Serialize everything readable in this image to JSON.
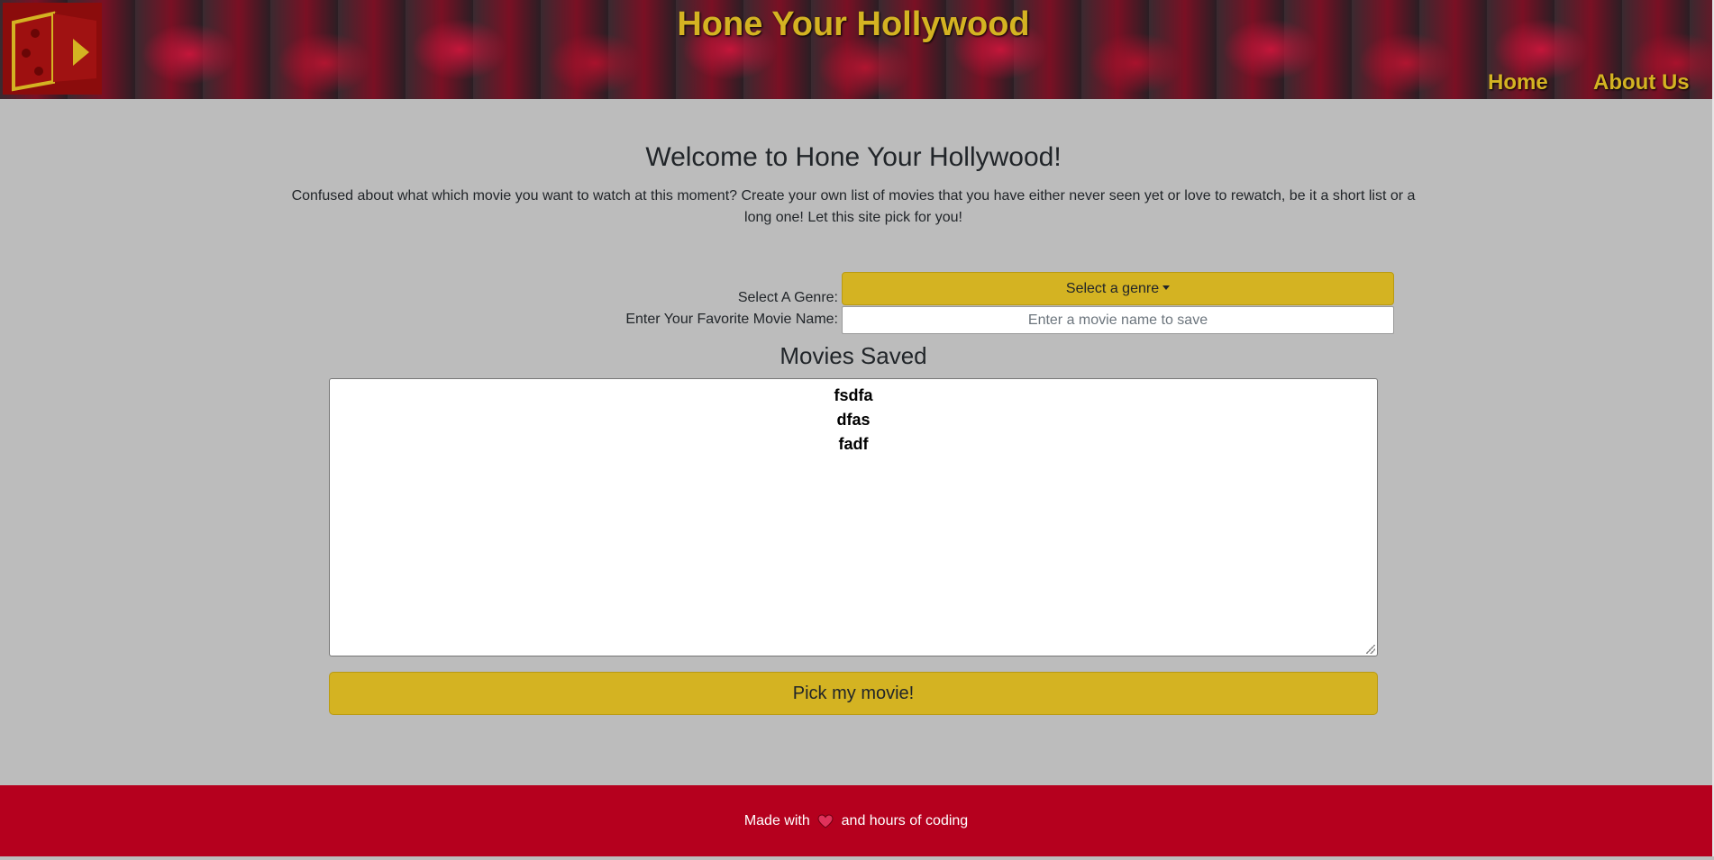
{
  "header": {
    "site_title": "Hone Your Hollywood",
    "nav": [
      {
        "label": "Home"
      },
      {
        "label": "About Us"
      }
    ],
    "logo_icon": "film-die-play-logo"
  },
  "main": {
    "welcome_heading": "Welcome to Hone Your Hollywood!",
    "intro_text": "Confused about what which movie you want to watch at this moment? Create your own list of movies that you have either never seen yet or love to rewatch, be it a short list or a long one! Let this site pick for you!",
    "genre_label": "Select A Genre:",
    "genre_button": "Select a genre",
    "movie_label": "Enter Your Favorite Movie Name:",
    "movie_placeholder": "Enter a movie name to save",
    "movie_value": "",
    "saved_heading": "Movies Saved",
    "saved_movies": [
      "fsdfa",
      "dfas",
      "fadf"
    ],
    "pick_button": "Pick my movie!"
  },
  "footer": {
    "text_before": "Made with",
    "heart_icon": "heart-icon",
    "text_after": "and hours of coding"
  },
  "colors": {
    "accent_gold": "#d4b322",
    "footer_red": "#b5001e",
    "page_bg": "#bcbcbc"
  }
}
